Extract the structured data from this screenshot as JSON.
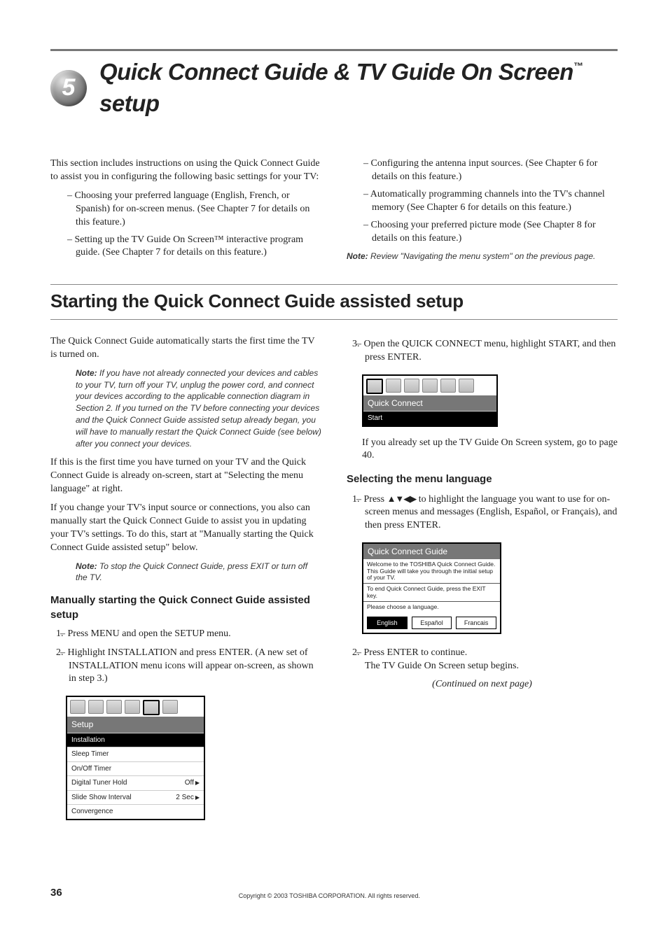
{
  "chapter": {
    "number": "5",
    "title_pre": "Quick Connect Guide & TV Guide On Screen",
    "title_tm": "™",
    "title_post": " setup"
  },
  "intro": {
    "lead": "This section includes instructions on using the Quick Connect Guide to assist you in configuring the following basic settings for your TV:",
    "bullets": [
      "Choosing your preferred language (English, French, or Spanish) for on-screen menus. (See Chapter 7 for details on this feature.)",
      "Setting up the TV Guide On Screen™ interactive program guide. (See Chapter 7 for details on this feature.)",
      "Configuring the antenna input sources. (See Chapter 6 for details on this feature.)",
      "Automatically programming channels into the TV's channel memory (See Chapter 6 for details on this feature.)",
      "Choosing your preferred picture mode (See Chapter 8 for details on this feature.)"
    ],
    "note_label": "Note:",
    "note": " Review \"Navigating the menu system\" on the previous page."
  },
  "section2_title": "Starting the Quick Connect Guide assisted setup",
  "col1": {
    "p1": "The Quick Connect Guide automatically starts the first time the TV is turned on.",
    "note1_label": "Note:",
    "note1": " If you have not already connected your devices and cables to your TV, turn off your TV, unplug the power cord, and connect your devices according to the applicable connection diagram in Section 2. If you turned on the TV before connecting your devices and the Quick Connect Guide assisted setup already began, you will have to manually restart the Quick Connect Guide (see below) after you connect your devices.",
    "p2": "If this is the first time you have turned on your TV and the Quick Connect Guide is already on-screen, start at \"Selecting the menu language\" at right.",
    "p3": "If you change your TV's input source or connections, you also can manually start the Quick Connect Guide to assist you in updating your TV's settings. To do this, start at \"Manually starting the Quick Connect Guide assisted setup\" below.",
    "note2_label": "Note:",
    "note2": " To stop the Quick Connect Guide, press EXIT or turn off the TV.",
    "h3a": "Manually starting the Quick Connect Guide assisted setup",
    "step1": "Press MENU and open the SETUP menu.",
    "step2": "Highlight INSTALLATION and press ENTER. (A new set of INSTALLATION menu icons will appear on-screen, as shown in step 3.)"
  },
  "ui_setup": {
    "title": "Setup",
    "items": [
      {
        "label": "Installation",
        "hl": true
      },
      {
        "label": "Sleep Timer"
      },
      {
        "label": "On/Off Timer"
      },
      {
        "label": "Digital Tuner Hold",
        "dots": true,
        "value": "Off",
        "arrow": true
      },
      {
        "label": "Slide Show Interval",
        "dots": true,
        "value": "2 Sec",
        "arrow": true
      },
      {
        "label": "Convergence"
      }
    ]
  },
  "col2": {
    "step3": "Open the QUICK CONNECT menu, highlight START, and then press ENTER.",
    "after3": "If you already set up the TV Guide On Screen system, go to page 40.",
    "h3b": "Selecting the menu language",
    "lang_step1_pre": "Press ",
    "lang_step1_post": " to highlight the language you want to use for on-screen menus and messages (English, Español, or Français), and then press ENTER.",
    "lang_step2a": "Press ENTER to continue.",
    "lang_step2b": "The TV Guide On Screen setup begins.",
    "continued": "(Continued on next page)"
  },
  "ui_qc": {
    "title": "Quick Connect",
    "item": "Start"
  },
  "ui_qcguide": {
    "title": "Quick Connect Guide",
    "welcome": "Welcome to the TOSHIBA Quick Connect Guide. This Guide will take you through the initial setup of your TV.",
    "exit": "To end Quick Connect Guide, press the EXIT key.",
    "choose": "Please choose a language.",
    "buttons": [
      "English",
      "Español",
      "Francais"
    ]
  },
  "footer": {
    "page": "36",
    "copyright": "Copyright © 2003 TOSHIBA CORPORATION. All rights reserved."
  }
}
